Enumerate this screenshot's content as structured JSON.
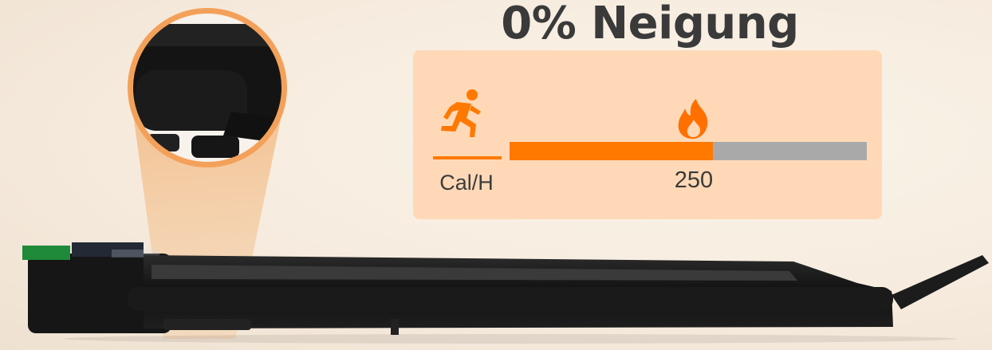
{
  "headline": "0% Neigung",
  "metric": {
    "unit_label": "Cal/H",
    "value_label": "250",
    "level_fraction": 0.57,
    "accent_color": "#ff7800",
    "track_color": "#a9a9a9"
  },
  "icons": {
    "runner": "running-person-icon",
    "flame": "flame-icon"
  }
}
